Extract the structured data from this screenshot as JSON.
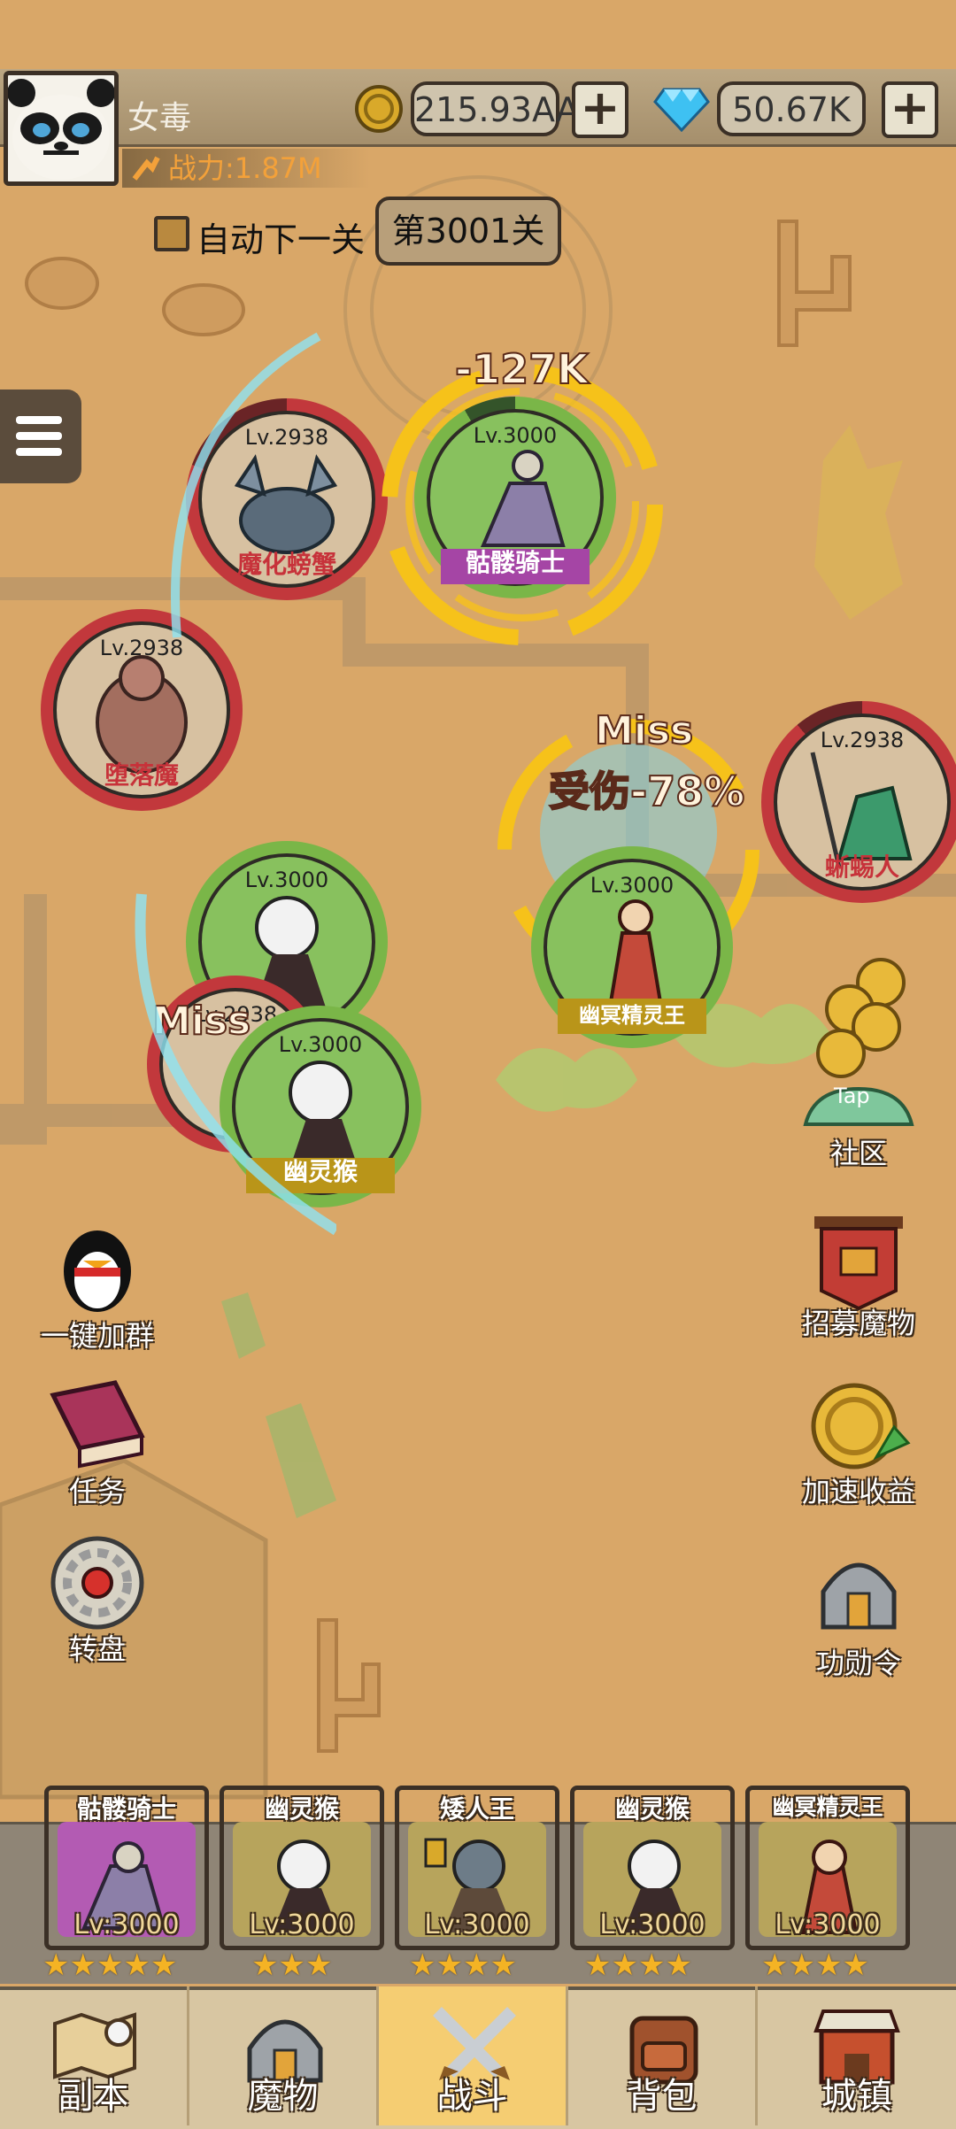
{
  "header": {
    "player_name": "女毒",
    "gold": "215.93AA",
    "gems": "50.67K",
    "power_label": "战力:1.87M",
    "auto_next_label": "自动下一关",
    "stage_label": "第3001关"
  },
  "battle": {
    "damage_popup": "-127K",
    "miss_popup_right": "Miss",
    "damage_reduction_popup": "受伤-78%",
    "miss_popup_left": "Miss",
    "units": [
      {
        "id": "enemy-crab",
        "level": "Lv.2938",
        "name": "魔化螃蟹",
        "side": "enemy"
      },
      {
        "id": "ally-skeleton-knight",
        "level": "Lv.3000",
        "name": "骷髅骑士",
        "side": "ally"
      },
      {
        "id": "enemy-fallen-demon",
        "level": "Lv.2938",
        "name": "堕落魔",
        "side": "enemy"
      },
      {
        "id": "enemy-lizardman",
        "level": "Lv.2938",
        "name": "蜥蜴人",
        "side": "enemy"
      },
      {
        "id": "ally-dark-elf-king",
        "level": "Lv.3000",
        "name": "幽冥精灵王",
        "side": "ally"
      },
      {
        "id": "ally-ghost-monkey-1",
        "level": "Lv.3000",
        "name": "",
        "side": "ally"
      },
      {
        "id": "enemy-hidden",
        "level": "Lv.2938",
        "name": "",
        "side": "enemy"
      },
      {
        "id": "ally-ghost-monkey-2",
        "level": "Lv.3000",
        "name": "幽灵猴",
        "side": "ally"
      }
    ]
  },
  "side_menu": {
    "community": "社区",
    "tap_label": "Tap",
    "recruit": "招募魔物",
    "speed_income": "加速收益",
    "merit": "功勋令",
    "join_group": "一键加群",
    "tasks": "任务",
    "wheel": "转盘"
  },
  "team": [
    {
      "name": "骷髅骑士",
      "level": "Lv:3000",
      "stars": "★★★★★",
      "color": "#b35bb3"
    },
    {
      "name": "幽灵猴",
      "level": "Lv:3000",
      "stars": "★★★",
      "color": "#b7a45c"
    },
    {
      "name": "矮人王",
      "level": "Lv:3000",
      "stars": "★★★★",
      "color": "#b7a45c"
    },
    {
      "name": "幽灵猴",
      "level": "Lv:3000",
      "stars": "★★★★",
      "color": "#b7a45c"
    },
    {
      "name": "幽冥精灵王",
      "level": "Lv:3000",
      "stars": "★★★★",
      "color": "#b7a45c"
    }
  ],
  "nav": {
    "dungeon": "副本",
    "monsters": "魔物",
    "battle": "战斗",
    "backpack": "背包",
    "town": "城镇"
  },
  "colors": {
    "ally_ring": "#7ab648",
    "enemy_ring": "#c2383c",
    "highlight": "#f6c21a",
    "sand": "#d9a768"
  }
}
